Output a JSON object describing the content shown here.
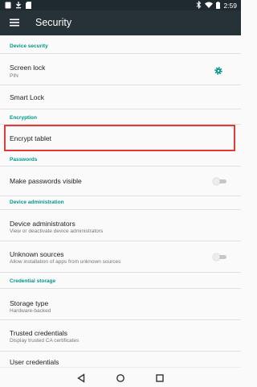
{
  "status_bar": {
    "time": "2:59",
    "left_icons": [
      "notification-icon",
      "download-icon",
      "sd-card-icon"
    ],
    "right_icons": [
      "bluetooth-icon",
      "wifi-icon",
      "battery-icon"
    ]
  },
  "app_bar": {
    "title": "Security",
    "menu_icon": "hamburger-menu-icon"
  },
  "sections": {
    "device_security": "Device security",
    "encryption": "Encryption",
    "passwords": "Passwords",
    "device_administration": "Device administration",
    "credential_storage": "Credential storage"
  },
  "items": {
    "screen_lock": {
      "title": "Screen lock",
      "summary": "PIN",
      "icon": "gear-icon"
    },
    "smart_lock": {
      "title": "Smart Lock"
    },
    "encrypt_tablet": {
      "title": "Encrypt tablet"
    },
    "make_passwords_visible": {
      "title": "Make passwords visible",
      "toggle": false
    },
    "device_administrators": {
      "title": "Device administrators",
      "summary": "View or deactivate device administrators"
    },
    "unknown_sources": {
      "title": "Unknown sources",
      "summary": "Allow installation of apps from unknown sources",
      "toggle": false
    },
    "storage_type": {
      "title": "Storage type",
      "summary": "Hardware-backed"
    },
    "trusted_credentials": {
      "title": "Trusted credentials",
      "summary": "Display trusted CA certificates"
    },
    "user_credentials": {
      "title": "User credentials"
    }
  },
  "nav_bar": [
    "back-icon",
    "home-icon",
    "recents-icon"
  ],
  "colors": {
    "accent": "#009688",
    "app_bar": "#263238",
    "status_bar": "#1f2a30",
    "highlight": "#e53935"
  }
}
